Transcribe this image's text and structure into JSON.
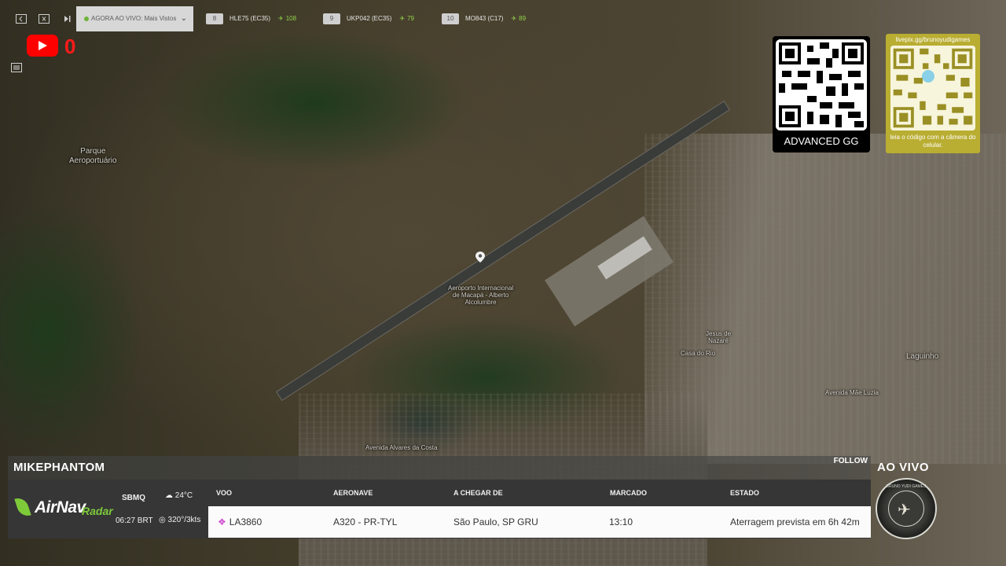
{
  "toolbar": {
    "live_label": "AGORA AO VIVO: Mais Vistos",
    "flights": [
      {
        "rank": "8",
        "callsign": "HLE75 (EC35)",
        "count": "108"
      },
      {
        "rank": "9",
        "callsign": "UKP042 (EC35)",
        "count": "79"
      },
      {
        "rank": "10",
        "callsign": "MO843 (C17)",
        "count": "89"
      }
    ]
  },
  "youtube": {
    "count": "0"
  },
  "map": {
    "labels": {
      "park": "Parque\nAeroportuário",
      "airport": "Aeroporto Internacional\nde Macapá - Alberto\nAlcolumbre",
      "jesus": "Jesus de\nNazaré",
      "laguinho": "Laguinho",
      "perpetuo": "Avenida Alvares da Costa",
      "jacaresinho": "Avenida Mãe Luzia",
      "casa": "Casa do Rio"
    }
  },
  "qr": {
    "advanced_label": "ADVANCED GG",
    "livepix_url": "livepix.gg/brunoyudigames",
    "livepix_caption": "leia o código com a câmera do celular."
  },
  "panel": {
    "user": "MIKEPHANTOM",
    "follow": "FOLLOW",
    "brand": "AirNav",
    "brand_suffix": "Radar",
    "airport": "SBMQ",
    "time": "06:27 BRT",
    "temp": "24°C",
    "wind": "320°/3kts",
    "headers": {
      "flight": "VOO",
      "aircraft": "AERONAVE",
      "from": "A CHEGAR DE",
      "scheduled": "MARCADO",
      "status": "ESTADO"
    },
    "row": {
      "flight": "LA3860",
      "aircraft": "A320 - PR-TYL",
      "from": "São Paulo, SP GRU",
      "scheduled": "13:10",
      "status": "Aterragem prevista em 6h 42m"
    }
  },
  "badge": {
    "live": "AO VIVO",
    "ring": "BRUNO YUDI GAMES"
  },
  "colors": {
    "brand_green": "#7ecb3a",
    "youtube_red": "#ff0000",
    "qr_gold": "#b9ad32"
  }
}
